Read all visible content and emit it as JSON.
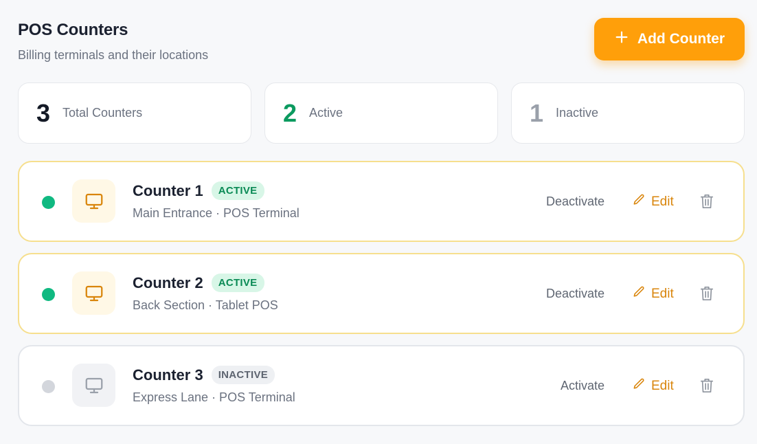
{
  "header": {
    "title": "POS Counters",
    "subtitle": "Billing terminals and their locations",
    "add_button_label": "Add Counter"
  },
  "stats": {
    "total": {
      "value": "3",
      "label": "Total Counters"
    },
    "active": {
      "value": "2",
      "label": "Active"
    },
    "inactive": {
      "value": "1",
      "label": "Inactive"
    }
  },
  "counters": [
    {
      "name": "Counter 1",
      "status": "ACTIVE",
      "details": "Main Entrance · POS Terminal",
      "toggle_label": "Deactivate",
      "edit_label": "Edit"
    },
    {
      "name": "Counter 2",
      "status": "ACTIVE",
      "details": "Back Section · Tablet POS",
      "toggle_label": "Deactivate",
      "edit_label": "Edit"
    },
    {
      "name": "Counter 3",
      "status": "INACTIVE",
      "details": "Express Lane · POS Terminal",
      "toggle_label": "Activate",
      "edit_label": "Edit"
    }
  ],
  "icons": {
    "add": "plus-icon",
    "terminal": "monitor-icon",
    "edit": "pencil-icon",
    "delete": "trash-icon"
  },
  "colors": {
    "accent": "#ff9f0a",
    "active_green": "#10b981",
    "active_border": "#f6df8e",
    "inactive_gray": "#d3d6dc",
    "edit_orange": "#d9850b"
  }
}
